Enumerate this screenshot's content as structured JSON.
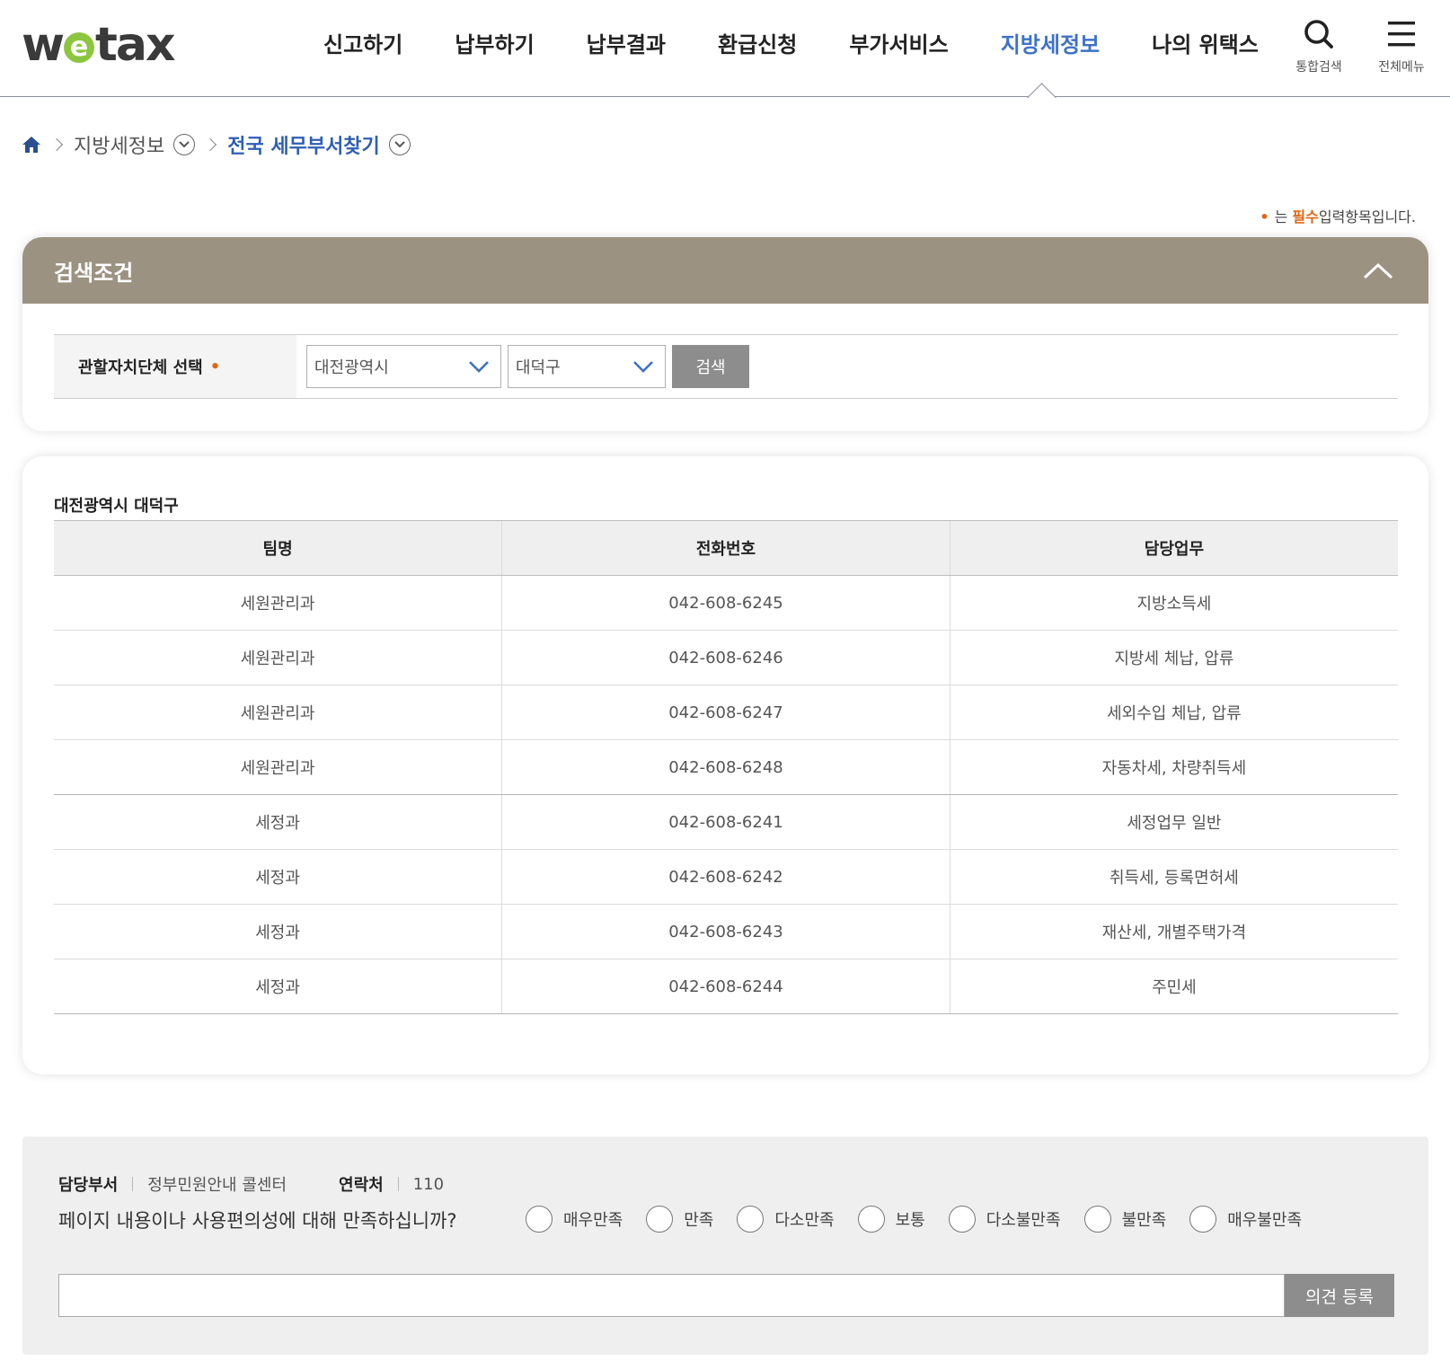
{
  "header": {
    "logo": {
      "prefix": "w",
      "e": "e",
      "suffix": "tax",
      "accent": "#8cc63f"
    },
    "nav": [
      "신고하기",
      "납부하기",
      "납부결과",
      "환급신청",
      "부가서비스",
      "지방세정보",
      "나의 위택스"
    ],
    "active_nav": "지방세정보",
    "search_label": "통합검색",
    "menu_label": "전체메뉴",
    "accent_color": "#3d72c9"
  },
  "breadcrumb": {
    "home_icon": "home-icon",
    "level1": "지방세정보",
    "level2": "전국 세무부서찾기"
  },
  "required_note": {
    "dot": "•",
    "prefix": "는",
    "required": "필수",
    "suffix": "입력항목입니다."
  },
  "search": {
    "title": "검색조건",
    "label": "관할자치단체 선택",
    "required_dot": "•",
    "sido_value": "대전광역시",
    "sigungu_value": "대덕구",
    "button": "검색",
    "header_color": "#9b9282"
  },
  "result": {
    "title": "대전광역시 대덕구",
    "columns": [
      "팀명",
      "전화번호",
      "담당업무"
    ],
    "rows": [
      [
        "세원관리과",
        "042-608-6245",
        "지방소득세"
      ],
      [
        "세원관리과",
        "042-608-6246",
        "지방세 체납, 압류"
      ],
      [
        "세원관리과",
        "042-608-6247",
        "세외수입 체납, 압류"
      ],
      [
        "세원관리과",
        "042-608-6248",
        "자동차세, 차량취득세"
      ],
      [
        "세정과",
        "042-608-6241",
        "세정업무 일반"
      ],
      [
        "세정과",
        "042-608-6242",
        "취득세, 등록면허세"
      ],
      [
        "세정과",
        "042-608-6243",
        "재산세, 개별주택가격"
      ],
      [
        "세정과",
        "042-608-6244",
        "주민세"
      ]
    ]
  },
  "feedback": {
    "dept_label": "담당부서",
    "dept_value": "정부민원안내 콜센터",
    "contact_label": "연락처",
    "contact_value": "110",
    "question": "페이지 내용이나 사용편의성에 대해 만족하십니까?",
    "options": [
      "매우만족",
      "만족",
      "다소만족",
      "보통",
      "다소불만족",
      "불만족",
      "매우불만족"
    ],
    "input_value": "",
    "submit": "의견 등록"
  }
}
